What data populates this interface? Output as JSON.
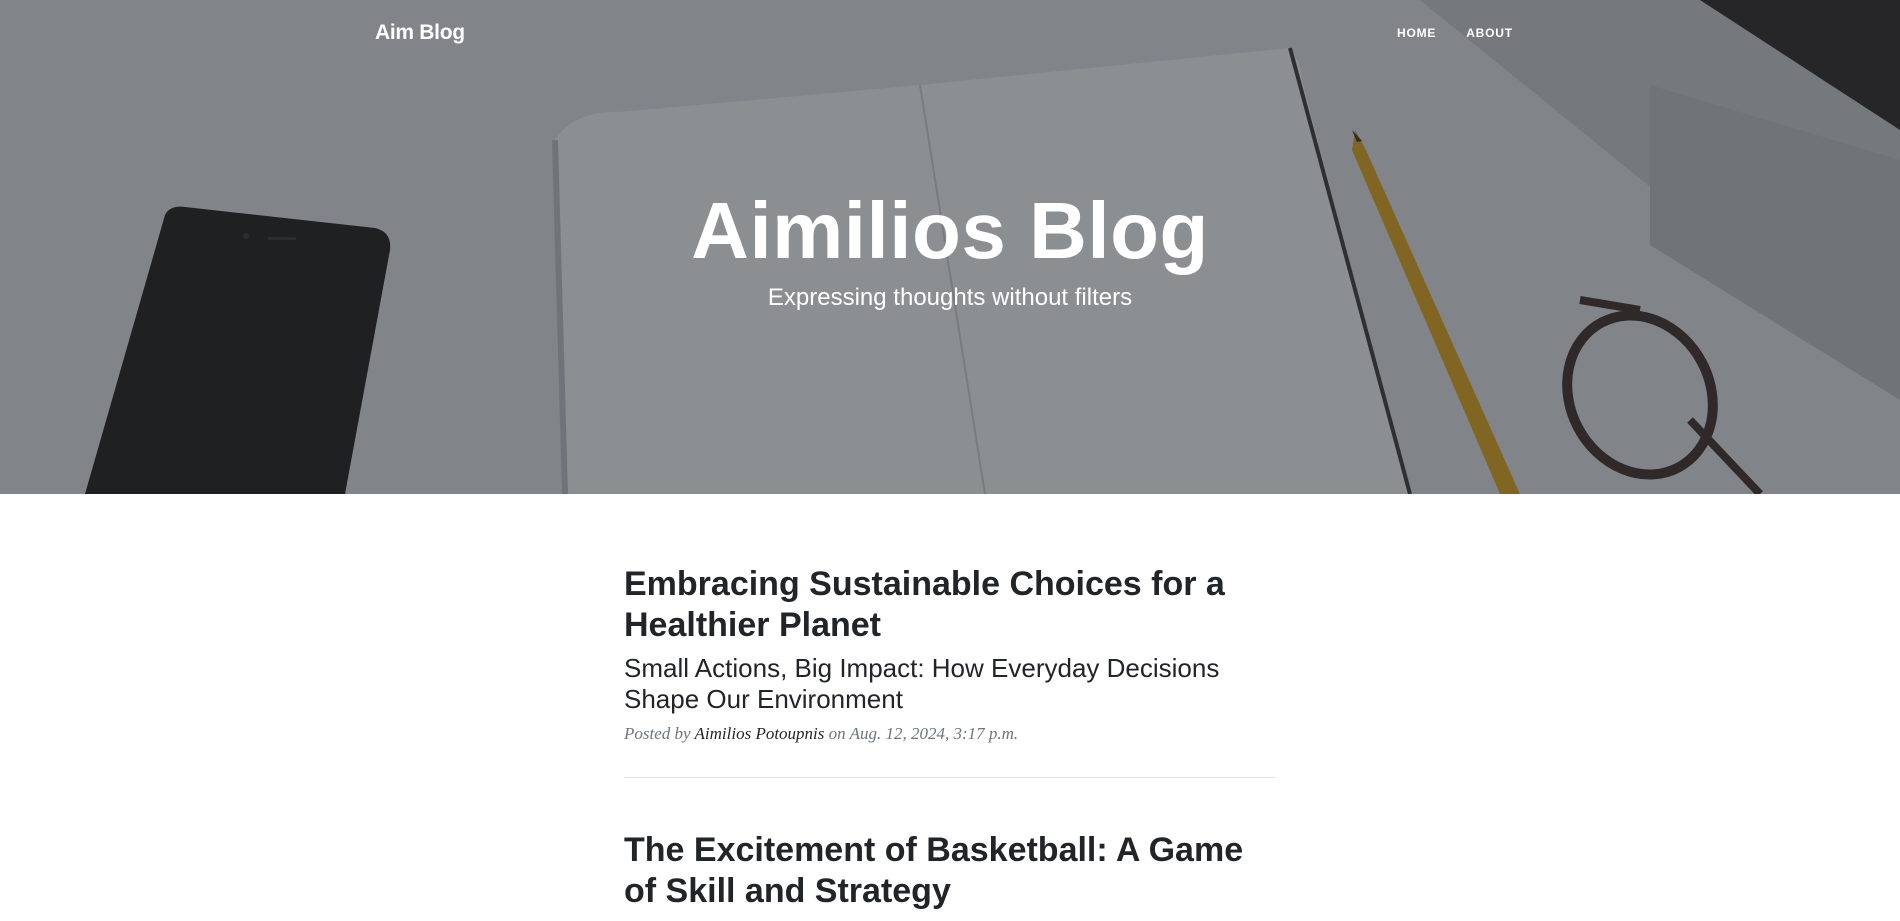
{
  "navbar": {
    "brand": "Aim Blog",
    "links": [
      {
        "label": "HOME"
      },
      {
        "label": "ABOUT"
      }
    ]
  },
  "masthead": {
    "title": "Aimilios Blog",
    "subtitle": "Expressing thoughts without filters"
  },
  "posts": [
    {
      "title": "Embracing Sustainable Choices for a Healthier Planet",
      "subtitle": "Small Actions, Big Impact: How Everyday Decisions Shape Our Environment",
      "meta_prefix": "Posted by",
      "author": "Aimilios Potoupnis",
      "meta_on": "on",
      "date": "Aug. 12, 2024, 3:17 p.m."
    },
    {
      "title": "The Excitement of Basketball: A Game of Skill and Strategy"
    }
  ],
  "colors": {
    "overlay": "#212529",
    "text": "#212529",
    "meta": "#6c757d",
    "divider": "#dee2e6"
  }
}
